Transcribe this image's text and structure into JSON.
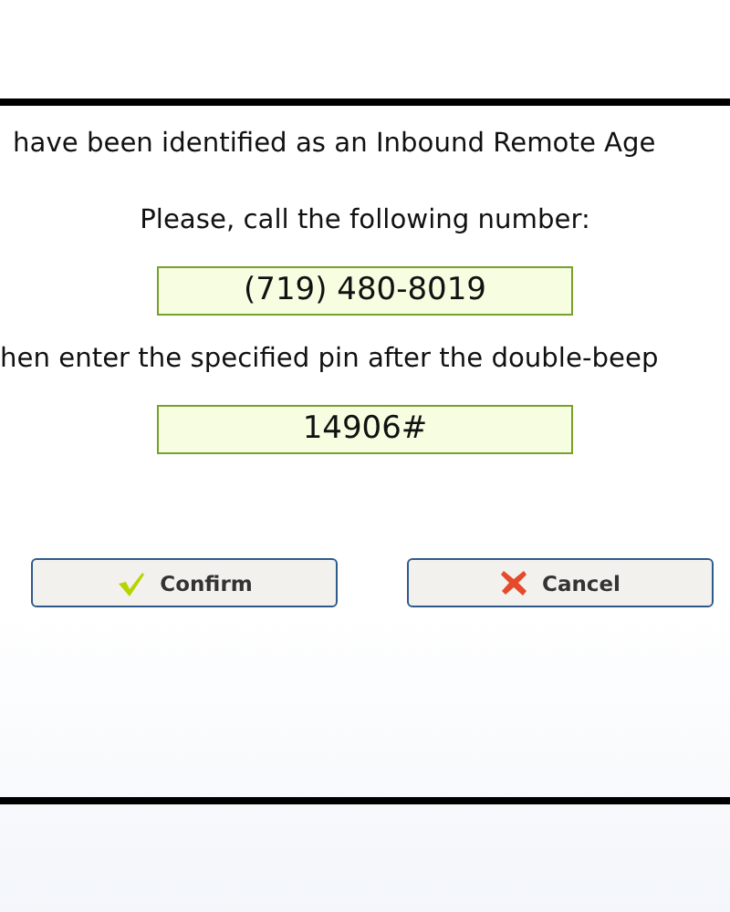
{
  "message_lines": [
    "have been identified as an Inbound Remote Age",
    "Please, call the following number:"
  ],
  "phone_number": "(719) 480-8019",
  "instruction": "hen enter the specified pin after the double-beep",
  "pin": "14906#",
  "buttons": [
    {
      "label": "Confirm",
      "kind": "confirm"
    },
    {
      "label": "Cancel",
      "kind": "cancel"
    }
  ]
}
